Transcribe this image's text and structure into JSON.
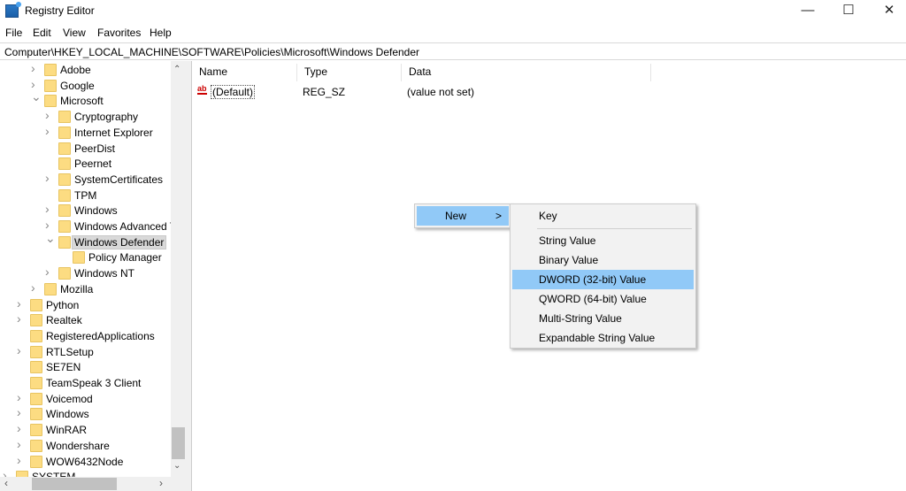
{
  "window": {
    "title": "Registry Editor",
    "minimize": "—",
    "maximize": "☐",
    "close": "✕"
  },
  "menubar": [
    "File",
    "Edit",
    "View",
    "Favorites",
    "Help"
  ],
  "address": "Computer\\HKEY_LOCAL_MACHINE\\SOFTWARE\\Policies\\Microsoft\\Windows Defender",
  "tree": [
    {
      "label": "Adobe",
      "level": 2,
      "exp": ">"
    },
    {
      "label": "Google",
      "level": 2,
      "exp": ">"
    },
    {
      "label": "Microsoft",
      "level": 2,
      "exp": "v"
    },
    {
      "label": "Cryptography",
      "level": 3,
      "exp": ">"
    },
    {
      "label": "Internet Explorer",
      "level": 3,
      "exp": ">"
    },
    {
      "label": "PeerDist",
      "level": 3,
      "exp": ""
    },
    {
      "label": "Peernet",
      "level": 3,
      "exp": ""
    },
    {
      "label": "SystemCertificates",
      "level": 3,
      "exp": ">"
    },
    {
      "label": "TPM",
      "level": 3,
      "exp": ""
    },
    {
      "label": "Windows",
      "level": 3,
      "exp": ">"
    },
    {
      "label": "Windows Advanced Threat Protection",
      "level": 3,
      "exp": ">"
    },
    {
      "label": "Windows Defender",
      "level": 3,
      "exp": "v",
      "selected": true
    },
    {
      "label": "Policy Manager",
      "level": 4,
      "exp": ""
    },
    {
      "label": "Windows NT",
      "level": 3,
      "exp": ">"
    },
    {
      "label": "Mozilla",
      "level": 2,
      "exp": ">"
    },
    {
      "label": "Python",
      "level": 1,
      "exp": ">"
    },
    {
      "label": "Realtek",
      "level": 1,
      "exp": ">"
    },
    {
      "label": "RegisteredApplications",
      "level": 1,
      "exp": ""
    },
    {
      "label": "RTLSetup",
      "level": 1,
      "exp": ">"
    },
    {
      "label": "SE7EN",
      "level": 1,
      "exp": ""
    },
    {
      "label": "TeamSpeak 3 Client",
      "level": 1,
      "exp": ""
    },
    {
      "label": "Voicemod",
      "level": 1,
      "exp": ">"
    },
    {
      "label": "Windows",
      "level": 1,
      "exp": ">"
    },
    {
      "label": "WinRAR",
      "level": 1,
      "exp": ">"
    },
    {
      "label": "Wondershare",
      "level": 1,
      "exp": ">"
    },
    {
      "label": "WOW6432Node",
      "level": 1,
      "exp": ">"
    },
    {
      "label": "SYSTEM",
      "level": 0,
      "exp": ">"
    }
  ],
  "columns": [
    "Name",
    "Type",
    "Data"
  ],
  "values": [
    {
      "name": "(Default)",
      "type": "REG_SZ",
      "data": "(value not set)",
      "icon": "ab-string-icon"
    }
  ],
  "context_menu": {
    "new_label": "New",
    "arrow": ">"
  },
  "submenu": [
    "Key",
    "String Value",
    "Binary Value",
    "DWORD (32-bit) Value",
    "QWORD (64-bit) Value",
    "Multi-String Value",
    "Expandable String Value"
  ],
  "submenu_highlighted": "DWORD (32-bit) Value",
  "colors": {
    "highlight": "#91c9f7",
    "folder": "#fcdc82"
  }
}
